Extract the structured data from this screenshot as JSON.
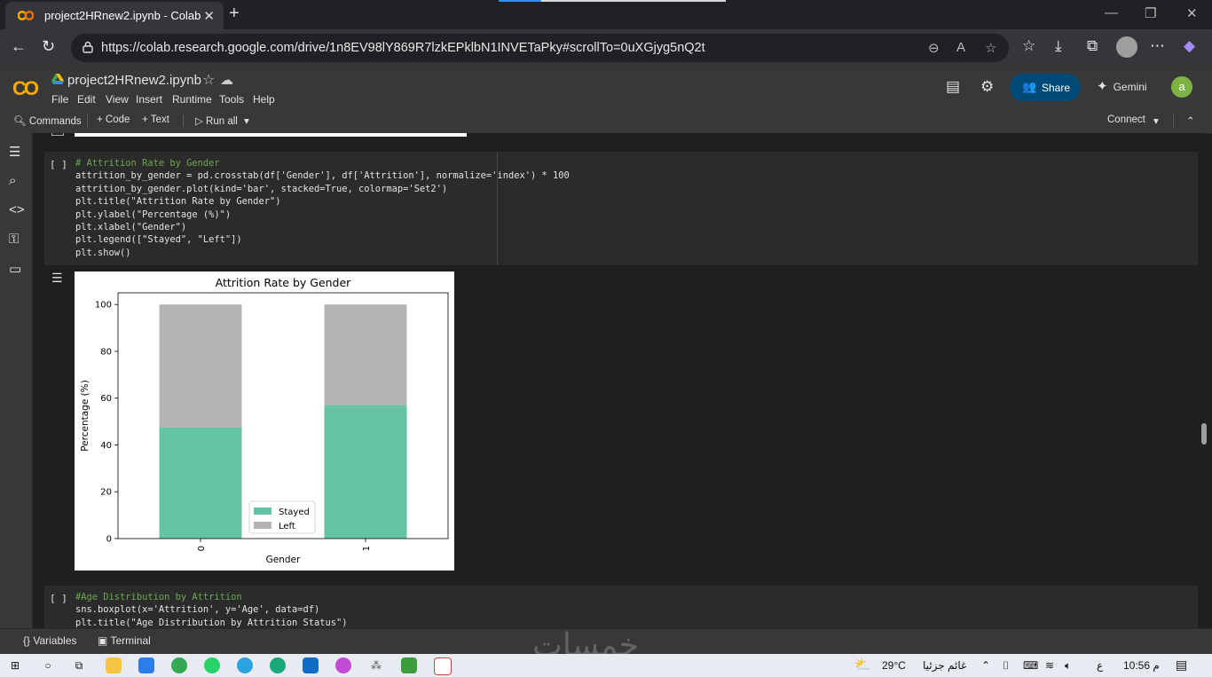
{
  "browser": {
    "tab_title": "project2HRnew2.ipynb - Colab",
    "url": "https://colab.research.google.com/drive/1n8EV98lY869R7lzkEPklbN1INVETaPky#scrollTo=0uXGjyg5nQ2t"
  },
  "colab": {
    "notebook_name": "project2HRnew2.ipynb",
    "menu": [
      "File",
      "Edit",
      "View",
      "Insert",
      "Runtime",
      "Tools",
      "Help"
    ],
    "share_label": "Share",
    "gemini_label": "Gemini",
    "avatar_letter": "a",
    "toolbar": {
      "commands": "Commands",
      "code": "+ Code",
      "text": "+ Text",
      "run_all": "Run all",
      "connect": "Connect"
    }
  },
  "cells": {
    "cell1": {
      "run_bracket": "[ ]",
      "lines": [
        "# Attrition Rate by Gender",
        "attrition_by_gender = pd.crosstab(df['Gender'], df['Attrition'], normalize='index') * 100",
        "attrition_by_gender.plot(kind='bar', stacked=True, colormap='Set2')",
        "plt.title(\"Attrition Rate by Gender\")",
        "plt.ylabel(\"Percentage (%)\")",
        "plt.xlabel(\"Gender\")",
        "plt.legend([\"Stayed\", \"Left\"])",
        "plt.show()"
      ]
    },
    "cell2": {
      "run_bracket": "[ ]",
      "lines": [
        "#Age Distribution by Attrition",
        "sns.boxplot(x='Attrition', y='Age', data=df)",
        "plt.title(\"Age Distribution by Attrition Status\")"
      ]
    }
  },
  "chart_data": {
    "type": "bar",
    "stacked": true,
    "title": "Attrition Rate by Gender",
    "xlabel": "Gender",
    "ylabel": "Percentage (%)",
    "categories": [
      "0",
      "1"
    ],
    "series": [
      {
        "name": "Stayed",
        "values": [
          47.5,
          57
        ],
        "color": "#66c2a5"
      },
      {
        "name": "Left",
        "values": [
          52.5,
          43
        ],
        "color": "#b3b3b3"
      }
    ],
    "yticks": [
      0,
      20,
      40,
      60,
      80,
      100
    ],
    "ylim": [
      0,
      105
    ],
    "legend_position": "lower center",
    "grid": false
  },
  "bottom": {
    "variables": "Variables",
    "terminal": "Terminal",
    "watermark": "خمسات"
  },
  "taskbar": {
    "temperature": "29°C",
    "weather": "غائم جزئيا",
    "lang": "ع",
    "time": "10:56 م"
  }
}
